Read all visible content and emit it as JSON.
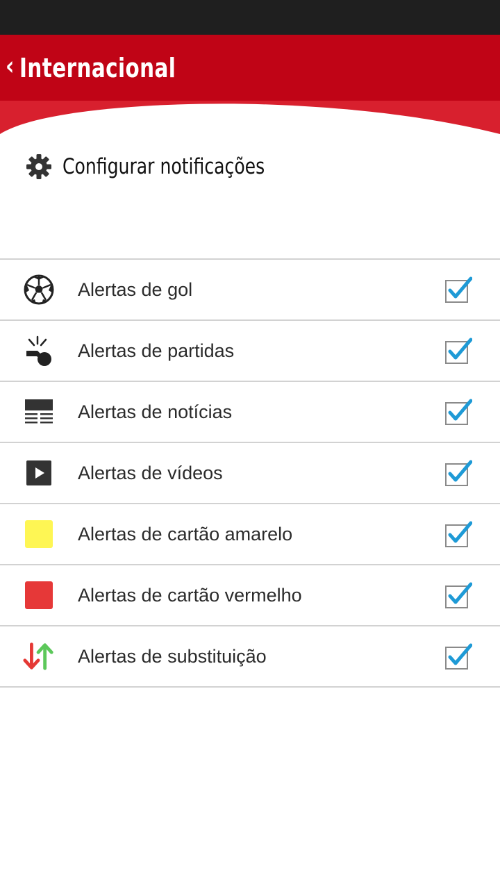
{
  "header": {
    "title": "Internacional"
  },
  "settings": {
    "title": "Configurar notificações"
  },
  "alerts": [
    {
      "label": "Alertas de gol",
      "icon": "soccer-ball-icon",
      "checked": true
    },
    {
      "label": "Alertas de partidas",
      "icon": "whistle-icon",
      "checked": true
    },
    {
      "label": "Alertas de notícias",
      "icon": "news-icon",
      "checked": true
    },
    {
      "label": "Alertas de vídeos",
      "icon": "video-play-icon",
      "checked": true
    },
    {
      "label": "Alertas de cartão amarelo",
      "icon": "yellow-card-icon",
      "checked": true,
      "color": "#fef654"
    },
    {
      "label": "Alertas de cartão vermelho",
      "icon": "red-card-icon",
      "checked": true,
      "color": "#e63838"
    },
    {
      "label": "Alertas de substituição",
      "icon": "substitution-arrows-icon",
      "checked": true
    }
  ],
  "colors": {
    "header": "#c00416",
    "check": "#1e9ad6"
  }
}
